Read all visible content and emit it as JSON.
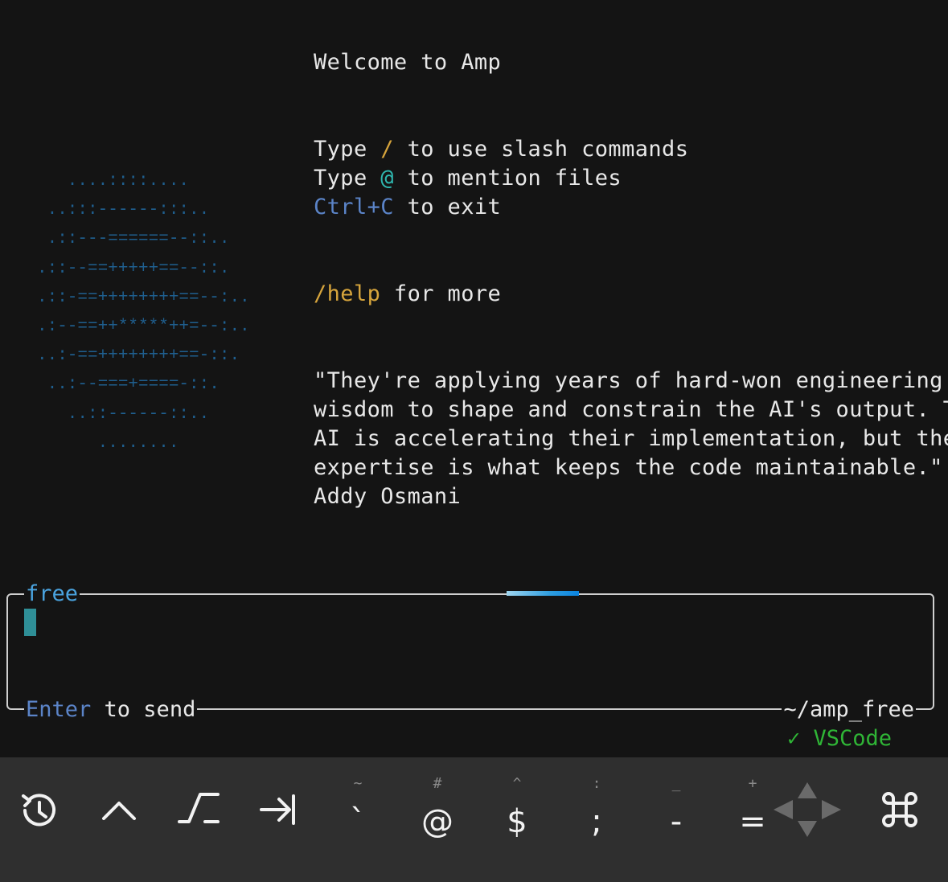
{
  "welcome": "Welcome to Amp",
  "hints": {
    "type1": "Type ",
    "slash": "/",
    "slash_rest": " to use slash commands",
    "type2": "Type ",
    "at": "@",
    "at_rest": " to mention files",
    "ctrl": "Ctrl+C",
    "ctrl_rest": " to exit",
    "help": "/help",
    "help_rest": " for more"
  },
  "quote_lines": [
    "\"They're applying years of hard-won engineering",
    "wisdom to shape and constrain the AI's output. The",
    "AI is accelerating their implementation, but their",
    "expertise is what keeps the code maintainable.\" -",
    "Addy Osmani"
  ],
  "logo_lines": [
    "   ....::::....",
    " ..:::------:::..",
    " .::---======--::..",
    ".::--==+++++==--::.",
    ".::-==++++++++==--:..",
    ".:--==++*****++=--:..",
    "..:-==++++++++==-::.",
    " ..:--===+====-::.",
    "   ..::------::..",
    "      ........"
  ],
  "input": {
    "mode_label": "free",
    "footer_enter": "Enter",
    "footer_rest": " to send",
    "cwd": "~/amp_free",
    "status": "✓ VSCode"
  },
  "keybar": {
    "tilde_sup": "~",
    "backtick": "`",
    "hash_sup": "#",
    "at": "@",
    "caret_sup": "^",
    "dollar": "$",
    "colon_sup": ":",
    "semicolon": ";",
    "underscore_sup": "_",
    "dash": "-",
    "plus_sup": "+",
    "equals": "="
  },
  "colors": {
    "accent_blue": "#4aa3df",
    "amber": "#d6a43c",
    "teal": "#2fb8b0",
    "green": "#2fb536"
  }
}
